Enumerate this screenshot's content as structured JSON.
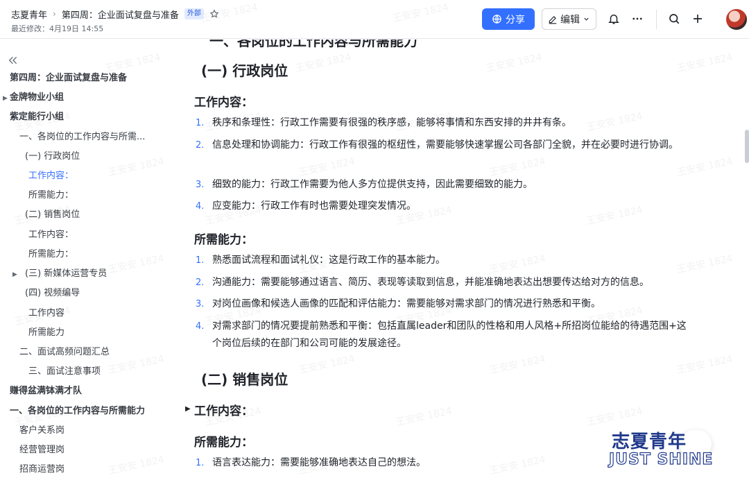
{
  "header": {
    "space_name": "志夏青年",
    "doc_title": "第四周：企业面试复盘与准备",
    "external_tag": "外部",
    "last_modified": "最近修改：4月19日 14:55",
    "share_label": "分享",
    "edit_label": "编辑"
  },
  "sidebar": {
    "items": [
      {
        "label": "第四周：企业面试复盘与准备"
      },
      {
        "label": "金牌物业小组"
      },
      {
        "label": "紫定能行小组"
      },
      {
        "label": "一、各岗位的工作内容与所需..."
      },
      {
        "label": "(一) 行政岗位"
      },
      {
        "label": "工作内容："
      },
      {
        "label": "所需能力："
      },
      {
        "label": "(二) 销售岗位"
      },
      {
        "label": "工作内容："
      },
      {
        "label": "所需能力："
      },
      {
        "label": "(三) 新媒体运营专员"
      },
      {
        "label": "(四) 视频编导"
      },
      {
        "label": "工作内容"
      },
      {
        "label": "所需能力"
      },
      {
        "label": "二、面试高频问题汇总"
      },
      {
        "label": "三、面试注意事项"
      },
      {
        "label": "赚得盆满钵满才队"
      },
      {
        "label": "一、各岗位的工作内容与所需能力"
      },
      {
        "label": "客户关系岗"
      },
      {
        "label": "经营管理岗"
      },
      {
        "label": "招商运营岗"
      }
    ]
  },
  "content": {
    "partial_heading": "一、各岗位的工作内容与所需能力",
    "section1_title": "(一) 行政岗位",
    "work_heading": "工作内容：",
    "work_items": [
      {
        "num": "1.",
        "text": "秩序和条理性：行政工作需要有很强的秩序感，能够将事情和东西安排的井井有条。"
      },
      {
        "num": "2.",
        "text": "信息处理和协调能力：行政工作有很强的枢纽性，需要能够快速掌握公司各部门全貌，并在必要时进行协调。"
      },
      {
        "num": "3.",
        "text": "细致的能力：行政工作需要为他人多方位提供支持，因此需要细致的能力。"
      },
      {
        "num": "4.",
        "text": "应变能力：行政工作有时也需要处理突发情况。"
      }
    ],
    "ability_heading": "所需能力：",
    "ability_items": [
      {
        "num": "1.",
        "text": "熟悉面试流程和面试礼仪：这是行政工作的基本能力。"
      },
      {
        "num": "2.",
        "text": "沟通能力：需要能够通过语言、简历、表现等读取到信息，并能准确地表达出想要传达给对方的信息。"
      },
      {
        "num": "3.",
        "text": "对岗位画像和候选人画像的匹配和评估能力：需要能够对需求部门的情况进行熟悉和平衡。"
      },
      {
        "num": "4.",
        "text": "对需求部门的情况要提前熟悉和平衡：包括直属leader和团队的性格和用人风格+所招岗位能给的待遇范围+这个岗位后续的在部门和公司可能的发展途径。"
      }
    ],
    "section2_title": "(二) 销售岗位",
    "sales_work_heading": "工作内容：",
    "sales_ability_heading": "所需能力：",
    "sales_ability_items": [
      {
        "num": "1.",
        "text": "语言表达能力：需要能够准确地表达自己的想法。"
      }
    ]
  },
  "watermark": "王安安 1824",
  "logo": {
    "cn": "志夏青年",
    "en": "JUST SHINE"
  },
  "colors": {
    "accent": "#3370ff",
    "active_toc": "#3370ff",
    "logo_blue": "#203a8c"
  }
}
